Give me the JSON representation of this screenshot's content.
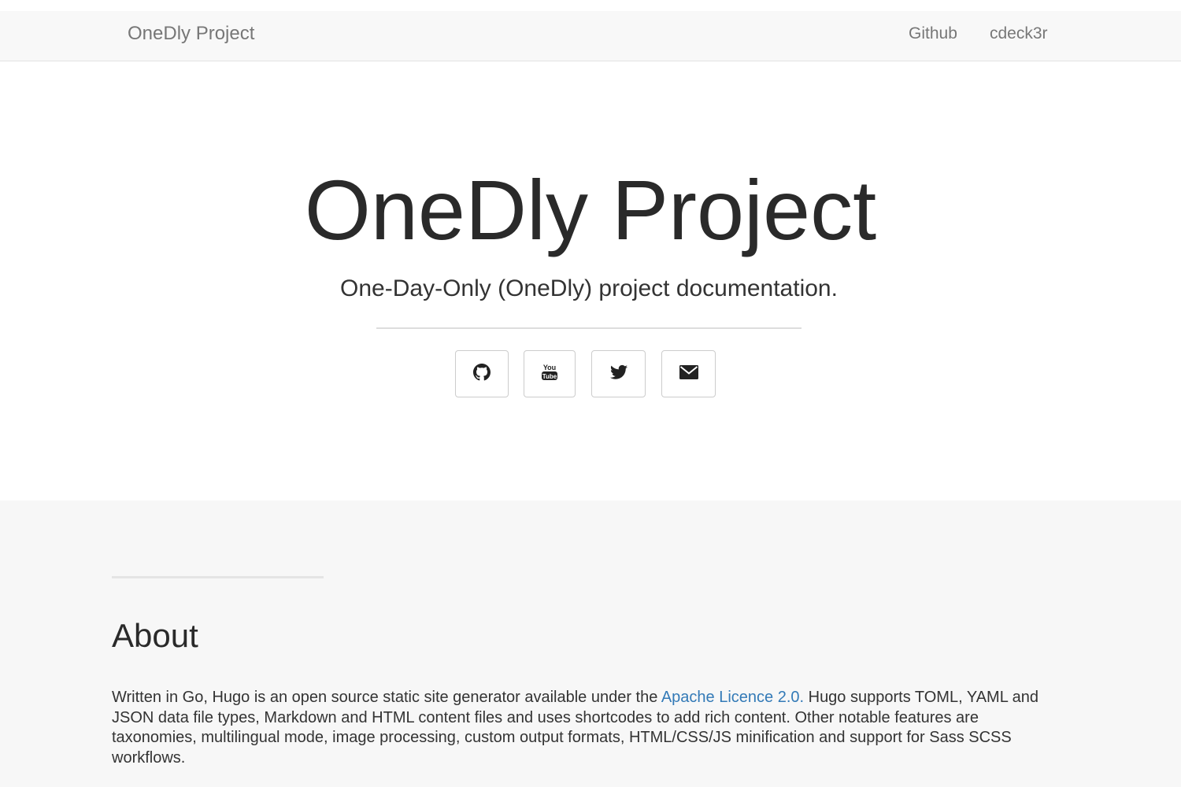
{
  "navbar": {
    "brand": "OneDly Project",
    "links": [
      "Github",
      "cdeck3r"
    ]
  },
  "hero": {
    "title": "OneDly Project",
    "subtitle": "One-Day-Only (OneDly) project documentation.",
    "social_buttons": [
      {
        "icon": "github-icon"
      },
      {
        "icon": "youtube-icon"
      },
      {
        "icon": "twitter-icon"
      },
      {
        "icon": "envelope-icon"
      }
    ]
  },
  "about": {
    "title": "About",
    "text_before_link": "Written in Go, Hugo is an open source static site generator available under the ",
    "link_text": "Apache Licence 2.0.",
    "text_after_link": " Hugo supports TOML, YAML and JSON data file types, Markdown and HTML content files and uses shortcodes to add rich content. Other notable features are taxonomies, multilingual mode, image processing, custom output formats, HTML/CSS/JS minification and support for Sass SCSS workflows."
  },
  "colors": {
    "navbar_bg": "#f8f8f8",
    "section_bg": "#f7f7f7",
    "link": "#337ab7"
  }
}
